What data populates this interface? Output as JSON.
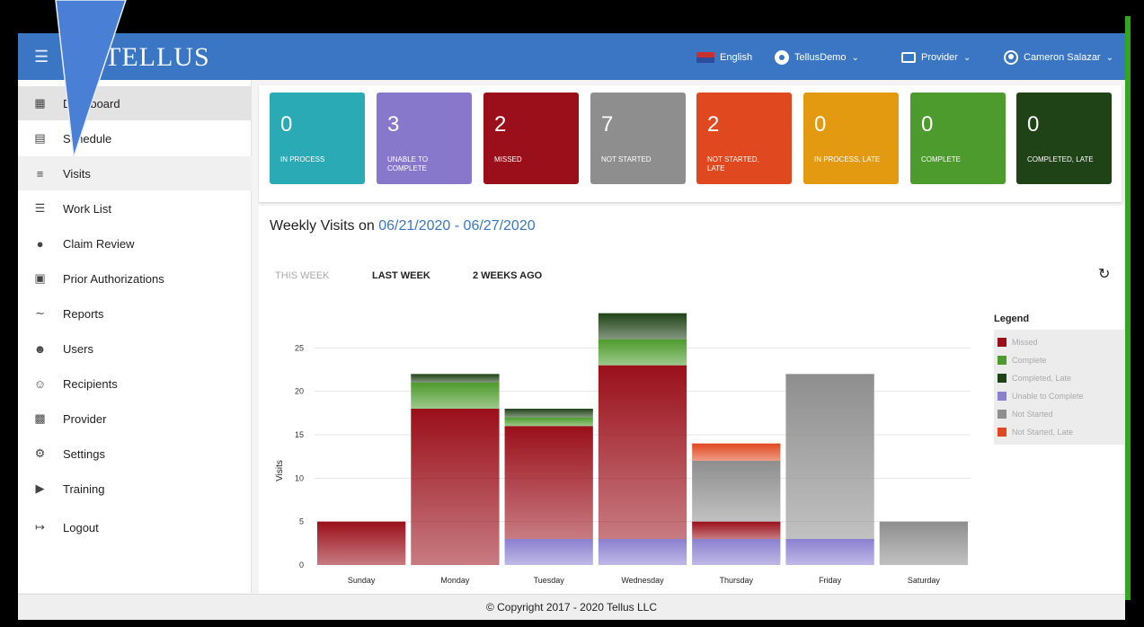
{
  "header": {
    "brand": "TELLUS",
    "language": "English",
    "account": "TellusDemo",
    "provider": "Provider",
    "user": "Cameron Salazar"
  },
  "sidebar": {
    "items": [
      {
        "label": "Dashboard",
        "icon": "dashboard-icon"
      },
      {
        "label": "Schedule",
        "icon": "calendar-icon"
      },
      {
        "label": "Visits",
        "icon": "filter-icon"
      },
      {
        "label": "Work List",
        "icon": "list-icon"
      },
      {
        "label": "Claim Review",
        "icon": "alert-icon"
      },
      {
        "label": "Prior Authorizations",
        "icon": "calendar-check-icon"
      },
      {
        "label": "Reports",
        "icon": "trending-icon"
      },
      {
        "label": "Users",
        "icon": "people-icon"
      },
      {
        "label": "Recipients",
        "icon": "people-outline-icon"
      },
      {
        "label": "Provider",
        "icon": "clipboard-icon"
      },
      {
        "label": "Settings",
        "icon": "gear-icon"
      },
      {
        "label": "Training",
        "icon": "video-icon"
      },
      {
        "label": "Logout",
        "icon": "logout-icon"
      }
    ]
  },
  "status_cards": [
    {
      "count": "0",
      "label": "IN PROCESS",
      "color": "#2aaab4"
    },
    {
      "count": "3",
      "label": "UNABLE TO COMPLETE",
      "color": "#8878cc"
    },
    {
      "count": "2",
      "label": "MISSED",
      "color": "#9a0f1a"
    },
    {
      "count": "7",
      "label": "NOT STARTED",
      "color": "#8e8e8e"
    },
    {
      "count": "2",
      "label": "NOT STARTED, LATE",
      "color": "#e0481f"
    },
    {
      "count": "0",
      "label": "IN PROCESS, LATE",
      "color": "#e39a10"
    },
    {
      "count": "0",
      "label": "COMPLETE",
      "color": "#4d9b2c"
    },
    {
      "count": "0",
      "label": "COMPLETED, LATE",
      "color": "#1f4316"
    }
  ],
  "chart": {
    "title_prefix": "Weekly Visits on",
    "date_range": "06/21/2020 - 06/27/2020",
    "tabs": [
      "THIS WEEK",
      "LAST WEEK",
      "2 WEEKS AGO"
    ]
  },
  "chart_data": {
    "type": "bar",
    "stacked": true,
    "categories": [
      "Sunday",
      "Monday",
      "Tuesday",
      "Wednesday",
      "Thursday",
      "Friday",
      "Saturday"
    ],
    "ylabel": "Visits",
    "xlabel": "",
    "ylim": [
      0,
      30
    ],
    "yticks": [
      0,
      5,
      10,
      15,
      20,
      25
    ],
    "grid": true,
    "legend_title": "Legend",
    "legend_position": "right",
    "series": [
      {
        "name": "Unable to Complete",
        "color": "#8b7fd0",
        "values": [
          0,
          0,
          3,
          3,
          3,
          3,
          0
        ]
      },
      {
        "name": "Missed",
        "color": "#9a0f1a",
        "values": [
          5,
          18,
          13,
          20,
          2,
          0,
          0
        ]
      },
      {
        "name": "Not Started",
        "color": "#8e8e8e",
        "values": [
          0,
          0,
          0,
          0,
          7,
          19,
          5
        ]
      },
      {
        "name": "Not Started, Late",
        "color": "#e0481f",
        "values": [
          0,
          0,
          0,
          0,
          2,
          0,
          0
        ]
      },
      {
        "name": "Complete",
        "color": "#4d9b2c",
        "values": [
          0,
          3,
          1,
          3,
          0,
          0,
          0
        ]
      },
      {
        "name": "Completed, Late",
        "color": "#1f4316",
        "values": [
          0,
          1,
          1,
          3,
          0,
          0,
          0
        ]
      }
    ],
    "legend_order": [
      "Missed",
      "Complete",
      "Completed, Late",
      "Unable to Complete",
      "Not Started",
      "Not Started, Late"
    ]
  },
  "footer": {
    "copyright": "© Copyright 2017 - 2020 Tellus LLC"
  }
}
